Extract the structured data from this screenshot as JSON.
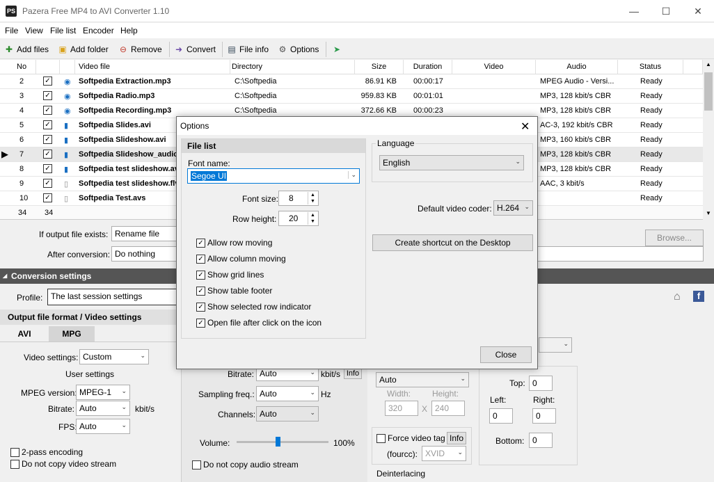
{
  "window": {
    "title": "Pazera Free MP4 to AVI Converter 1.10",
    "app_icon_text": "PS"
  },
  "menu": [
    "File",
    "View",
    "File list",
    "Encoder",
    "Help"
  ],
  "toolbar": {
    "add_files": "Add files",
    "add_folder": "Add folder",
    "remove": "Remove",
    "convert": "Convert",
    "file_info": "File info",
    "options": "Options"
  },
  "grid": {
    "headers": {
      "no": "No",
      "video_file": "Video file",
      "directory": "Directory",
      "size": "Size",
      "duration": "Duration",
      "video": "Video",
      "audio": "Audio",
      "status": "Status"
    },
    "rows": [
      {
        "no": "2",
        "file": "Softpedia Extraction.mp3",
        "dir": "C:\\Softpedia",
        "size": "86.91 KB",
        "duration": "00:00:17",
        "audio": "MPEG Audio - Versi...",
        "status": "Ready"
      },
      {
        "no": "3",
        "file": "Softpedia Radio.mp3",
        "dir": "C:\\Softpedia",
        "size": "959.83 KB",
        "duration": "00:01:01",
        "audio": "MP3, 128 kbit/s  CBR",
        "status": "Ready"
      },
      {
        "no": "4",
        "file": "Softpedia Recording.mp3",
        "dir": "C:\\Softpedia",
        "size": "372.66 KB",
        "duration": "00:00:23",
        "audio": "MP3, 128 kbit/s  CBR",
        "status": "Ready"
      },
      {
        "no": "5",
        "file": "Softpedia Slides.avi",
        "dir": "",
        "size": "",
        "duration": "",
        "audio": "AC-3, 192 kbit/s  CBR",
        "status": "Ready"
      },
      {
        "no": "6",
        "file": "Softpedia Slideshow.avi",
        "dir": "",
        "size": "",
        "duration": "",
        "audio": "MP3, 160 kbit/s  CBR",
        "status": "Ready"
      },
      {
        "no": "7",
        "file": "Softpedia Slideshow_audio",
        "dir": "",
        "size": "",
        "duration": "",
        "audio": "MP3, 128 kbit/s  CBR",
        "status": "Ready"
      },
      {
        "no": "8",
        "file": "Softpedia test slideshow.avi",
        "dir": "",
        "size": "",
        "duration": "",
        "audio": "MP3, 128 kbit/s  CBR",
        "status": "Ready"
      },
      {
        "no": "9",
        "file": "Softpedia test slideshow.flv",
        "dir": "",
        "size": "",
        "duration": "",
        "audio": "AAC, 3 kbit/s",
        "status": "Ready"
      },
      {
        "no": "10",
        "file": "Softpedia Test.avs",
        "dir": "",
        "size": "",
        "duration": "",
        "audio": "",
        "status": "Ready"
      }
    ],
    "footer": {
      "count": "34",
      "checked": "34"
    }
  },
  "output": {
    "exists_label": "If output file exists:",
    "exists_value": "Rename file",
    "after_label": "After conversion:",
    "after_value": "Do nothing",
    "browse": "Browse..."
  },
  "conversion": {
    "section": "Conversion settings",
    "profile_label": "Profile:",
    "profile_value": "The last session settings",
    "output_format": "Output file format / Video settings",
    "tabs": [
      "AVI",
      "MPG"
    ],
    "video_settings_label": "Video settings:",
    "video_settings_value": "Custom",
    "user_settings": "User settings",
    "mpeg_label": "MPEG version:",
    "mpeg_value": "MPEG-1",
    "bitrate_label": "Bitrate:",
    "bitrate_value": "Auto",
    "bitrate_unit": "kbit/s",
    "fps_label": "FPS:",
    "fps_value": "Auto",
    "two_pass": "2-pass encoding",
    "no_copy_video": "Do not copy video stream",
    "audio_bitrate_label": "Bitrate:",
    "audio_bitrate_value": "Auto",
    "audio_bitrate_unit": "kbit/s",
    "info": "Info",
    "sampling_label": "Sampling freq.:",
    "sampling_value": "Auto",
    "sampling_unit": "Hz",
    "channels_label": "Channels:",
    "channels_value": "Auto",
    "volume_label": "Volume:",
    "volume_value": "100%",
    "volume_level": 0.45,
    "no_copy_audio": "Do not copy audio stream",
    "resize_value": "Auto",
    "width_label": "Width:",
    "height_label": "Height:",
    "width_value": "320",
    "height_value": "240",
    "x": "X",
    "top_label": "Top:",
    "top_value": "0",
    "left_label": "Left:",
    "left_value": "0",
    "right_label": "Right:",
    "right_value": "0",
    "bottom_label": "Bottom:",
    "bottom_value": "0",
    "force_tag": "Force video tag",
    "fourcc_label": "(fourcc):",
    "fourcc_value": "XVID",
    "deinterlacing": "Deinterlacing"
  },
  "dialog": {
    "title": "Options",
    "file_list": "File list",
    "font_name_label": "Font name:",
    "font_name_value": "Segoe UI",
    "font_size_label": "Font size:",
    "font_size_value": "8",
    "row_height_label": "Row height:",
    "row_height_value": "20",
    "checkboxes": [
      "Allow row moving",
      "Allow column moving",
      "Show grid lines",
      "Show table footer",
      "Show selected row indicator",
      "Open file after click on the icon"
    ],
    "language_label": "Language",
    "language_value": "English",
    "default_coder_label": "Default video coder:",
    "default_coder_value": "H.264",
    "shortcut": "Create shortcut on the Desktop",
    "close": "Close"
  },
  "colors": {
    "selection": "#0078d7",
    "section_bar": "#555555"
  }
}
